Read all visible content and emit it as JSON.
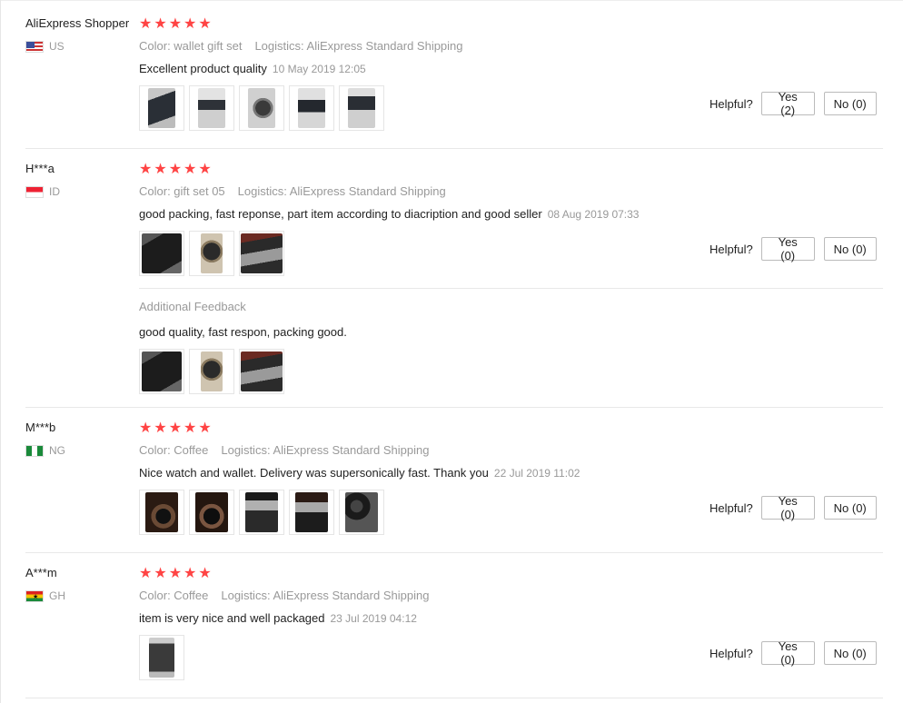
{
  "helpful_label": "Helpful?",
  "additional_feedback_label": "Additional Feedback",
  "colors": {
    "star": "#ff4444",
    "muted": "#999999",
    "text": "#222222"
  },
  "reviews": [
    {
      "user": "AliExpress Shopper",
      "country": "US",
      "rating": 5,
      "color": "Color: wallet gift set",
      "logistics": "Logistics: AliExpress Standard Shipping",
      "text": "Excellent product quality",
      "date": "10 May 2019 12:05",
      "yes": "Yes (2)",
      "no": "No (0)",
      "images": [
        "photo-wallet-box",
        "photo-gift-box",
        "photo-watch",
        "photo-gift-box",
        "photo-gift-box"
      ]
    },
    {
      "user": "H***a",
      "country": "ID",
      "rating": 5,
      "color": "Color: gift set 05",
      "logistics": "Logistics: AliExpress Standard Shipping",
      "text": "good packing, fast reponse, part item according to diacription and good seller",
      "date": "08 Aug 2019 07:33",
      "yes": "Yes (0)",
      "no": "No (0)",
      "images": [
        "photo-wallet-box",
        "photo-watch",
        "photo-wallet-box"
      ],
      "additional": {
        "text": "good quality, fast respon, packing good.",
        "images": [
          "photo-wallet-box",
          "photo-watch",
          "photo-wallet-box"
        ]
      }
    },
    {
      "user": "M***b",
      "country": "NG",
      "rating": 5,
      "color": "Color: Coffee",
      "logistics": "Logistics: AliExpress Standard Shipping",
      "text": "Nice watch and wallet. Delivery was supersonically fast. Thank you",
      "date": "22 Jul 2019 11:02",
      "yes": "Yes (0)",
      "no": "No (0)",
      "images": [
        "photo-watch",
        "photo-watch",
        "photo-gift-box",
        "photo-gift-box",
        "photo-watch"
      ]
    },
    {
      "user": "A***m",
      "country": "GH",
      "rating": 5,
      "color": "Color: Coffee",
      "logistics": "Logistics: AliExpress Standard Shipping",
      "text": "item is very nice and well packaged",
      "date": "23 Jul 2019 04:12",
      "yes": "Yes (0)",
      "no": "No (0)",
      "images": [
        "photo-gift-box"
      ]
    }
  ]
}
